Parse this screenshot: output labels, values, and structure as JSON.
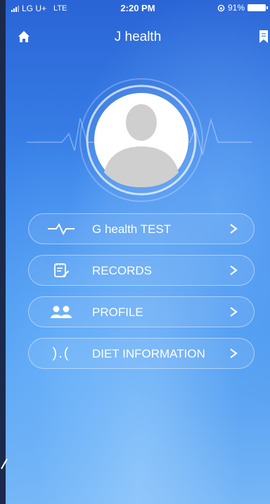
{
  "status_bar": {
    "carrier": "LG U+",
    "network": "LTE",
    "time": "2:20 PM",
    "battery_percent": "91%"
  },
  "header": {
    "title": "J health",
    "home_icon": "home-icon",
    "bookmark_icon": "bookmark-icon"
  },
  "profile": {
    "avatar_icon": "user-silhouette-icon"
  },
  "menu": [
    {
      "label": "G health TEST",
      "icon": "heartbeat-icon"
    },
    {
      "label": "RECORDS",
      "icon": "notepad-icon"
    },
    {
      "label": "PROFILE",
      "icon": "users-icon"
    },
    {
      "label": "DIET INFORMATION",
      "icon_text": ").("
    }
  ],
  "colors": {
    "background_top": "#2a64d6",
    "background_bottom": "#76b6f6",
    "text": "#ffffff"
  }
}
